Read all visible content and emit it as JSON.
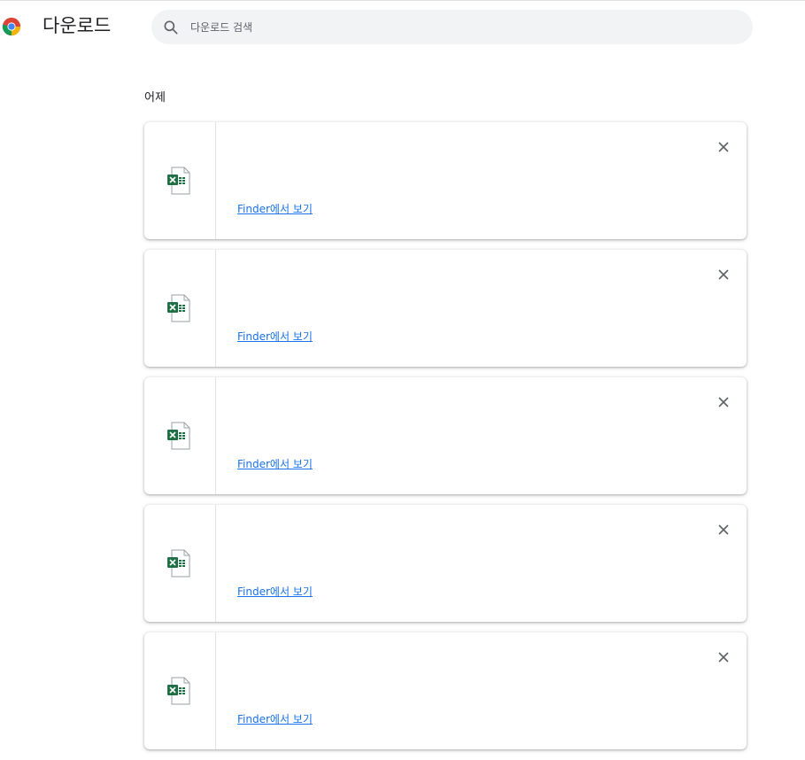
{
  "header": {
    "title": "다운로드",
    "search": {
      "placeholder": "다운로드 검색",
      "value": ""
    }
  },
  "section": {
    "date_label": "어제"
  },
  "downloads": [
    {
      "file_name": "",
      "action_label": "Finder에서 보기",
      "file_icon": "excel-file-icon"
    },
    {
      "file_name": "",
      "action_label": "Finder에서 보기",
      "file_icon": "excel-file-icon"
    },
    {
      "file_name": "",
      "action_label": "Finder에서 보기",
      "file_icon": "excel-file-icon"
    },
    {
      "file_name": "",
      "action_label": "Finder에서 보기",
      "file_icon": "excel-file-icon"
    },
    {
      "file_name": "",
      "action_label": "Finder에서 보기",
      "file_icon": "excel-file-icon"
    }
  ],
  "colors": {
    "link": "#1a73e8",
    "search_background": "#f1f3f4",
    "excel_green": "#1e7145"
  }
}
